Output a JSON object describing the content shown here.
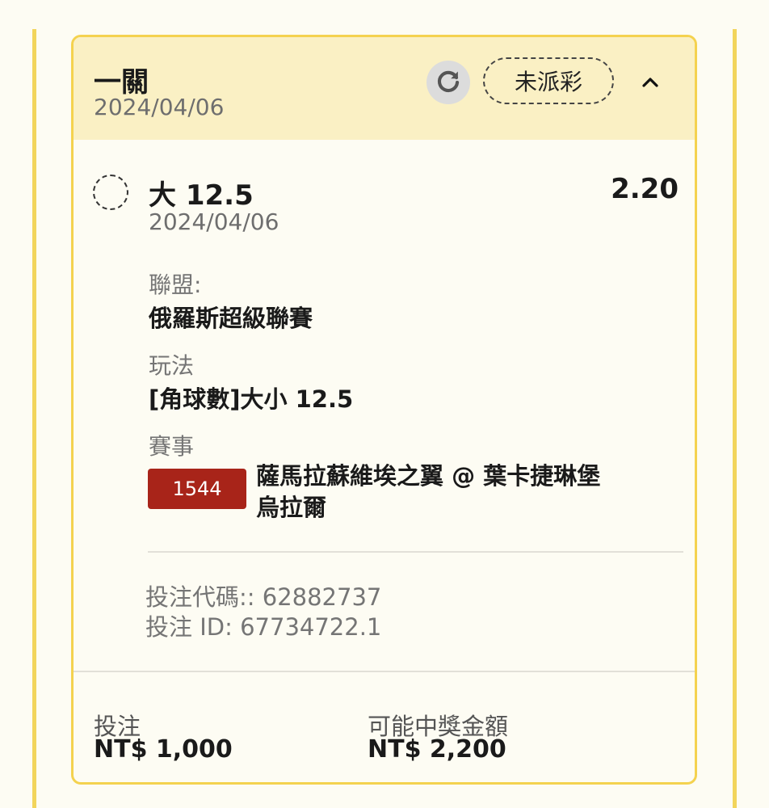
{
  "bet": {
    "type": "一關",
    "date": "2024/04/06",
    "status": "未派彩",
    "icons": {
      "refresh": "refresh-icon",
      "collapse": "chevron-up-icon"
    }
  },
  "selection": {
    "name": "大 12.5",
    "date": "2024/04/06",
    "odds": "2.20",
    "league_label": "聯盟:",
    "league": "俄羅斯超級聯賽",
    "market_label": "玩法",
    "market": "[角球數]大小 12.5",
    "event_label": "賽事",
    "event_id": "1544",
    "event_name": "薩馬拉蘇維埃之翼 @ 葉卡捷琳堡烏拉爾",
    "event_id_color": "#a82419"
  },
  "codes": {
    "bet_code": "投注代碼:: 62882737",
    "bet_id": "投注 ID: 67734722.1"
  },
  "footer": {
    "stake_label": "投注",
    "stake": "NT$ 1,000",
    "payout_label": "可能中獎金額",
    "payout": "NT$ 2,200"
  },
  "colors": {
    "accent": "#f4d24f",
    "header_bg": "#faf0c4",
    "page_bg": "#fdfcf3"
  }
}
